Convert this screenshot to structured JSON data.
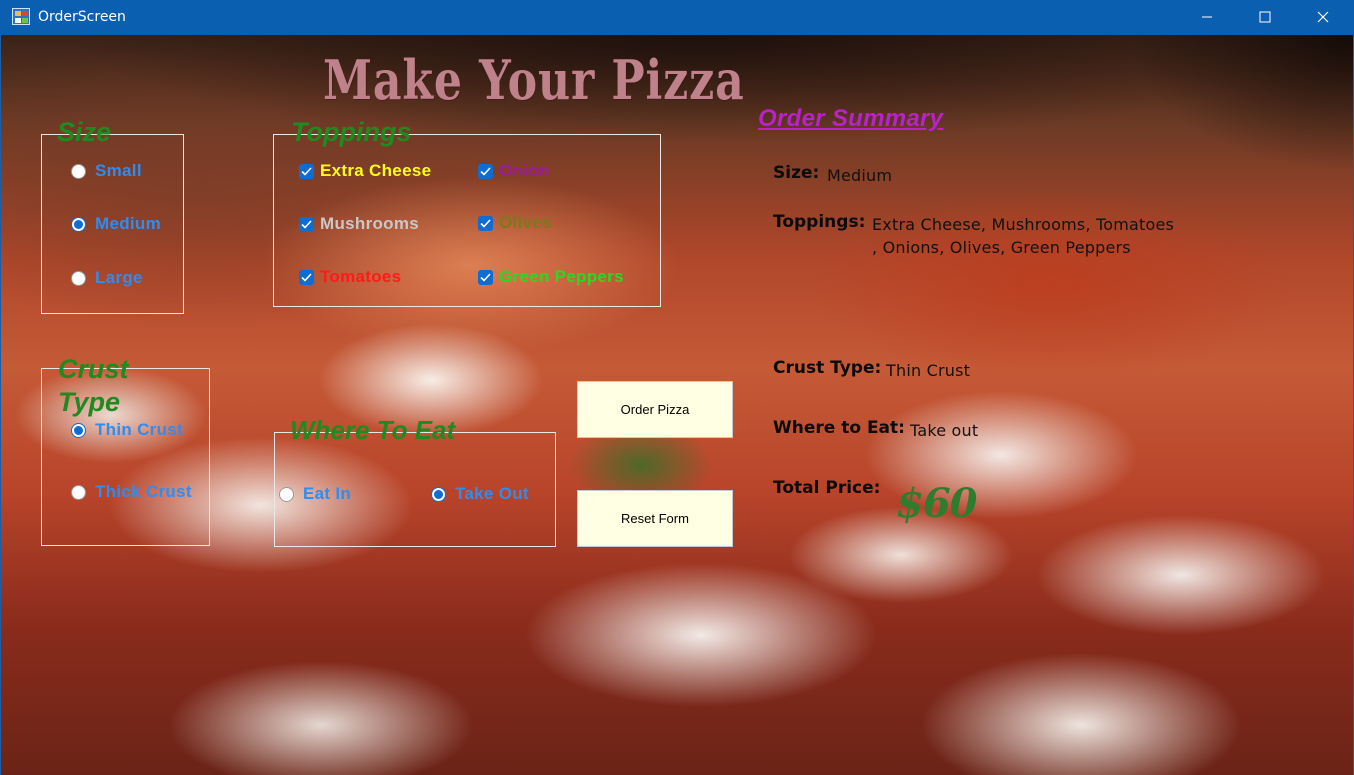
{
  "window": {
    "title": "OrderScreen"
  },
  "header": {
    "title": "Make Your Pizza"
  },
  "size_group": {
    "legend": "Size",
    "options": [
      {
        "label": "Small",
        "selected": false
      },
      {
        "label": "Medium",
        "selected": true
      },
      {
        "label": "Large",
        "selected": false
      }
    ]
  },
  "toppings_group": {
    "legend": "Toppings",
    "items": [
      {
        "label": "Extra Cheese",
        "checked": true,
        "color": "#ffff1a"
      },
      {
        "label": "Onion",
        "checked": true,
        "color": "#9c1a9c"
      },
      {
        "label": "Mushrooms",
        "checked": true,
        "color": "#c8c8c8"
      },
      {
        "label": "Olives",
        "checked": true,
        "color": "#7a7a1a"
      },
      {
        "label": "Tomatoes",
        "checked": true,
        "color": "#ff1a1a"
      },
      {
        "label": "Green Peppers",
        "checked": true,
        "color": "#22dd22"
      }
    ]
  },
  "crust_group": {
    "legend_line1": "Crust",
    "legend_line2": "Type",
    "options": [
      {
        "label": "Thin Crust",
        "selected": true
      },
      {
        "label": "Thick Crust",
        "selected": false
      }
    ]
  },
  "where_group": {
    "legend": "Where To Eat",
    "options": [
      {
        "label": "Eat In",
        "selected": false
      },
      {
        "label": "Take Out",
        "selected": true
      }
    ]
  },
  "buttons": {
    "order": "Order Pizza",
    "reset": "Reset Form"
  },
  "summary": {
    "title": "Order Summary",
    "size_label": "Size:",
    "size_value": "Medium",
    "toppings_label": "Toppings:",
    "toppings_line1": "Extra Cheese, Mushrooms, Tomatoes",
    "toppings_line2": ", Onions, Olives, Green Peppers",
    "crust_label": "Crust Type:",
    "crust_value": "Thin Crust",
    "where_label": "Where to Eat:",
    "where_value": "Take out",
    "total_label": "Total Price:",
    "total_value": "$60"
  },
  "colors": {
    "titlebar": "#0b5fb0",
    "legend": "#1f8a1f",
    "option_text": "#2f8cf0",
    "radio_accent": "#0f6cd1",
    "button_bg": "#ffffe3",
    "summary_title": "#b822c7",
    "price": "#2f7c2f",
    "page_title": "#c0828a"
  }
}
